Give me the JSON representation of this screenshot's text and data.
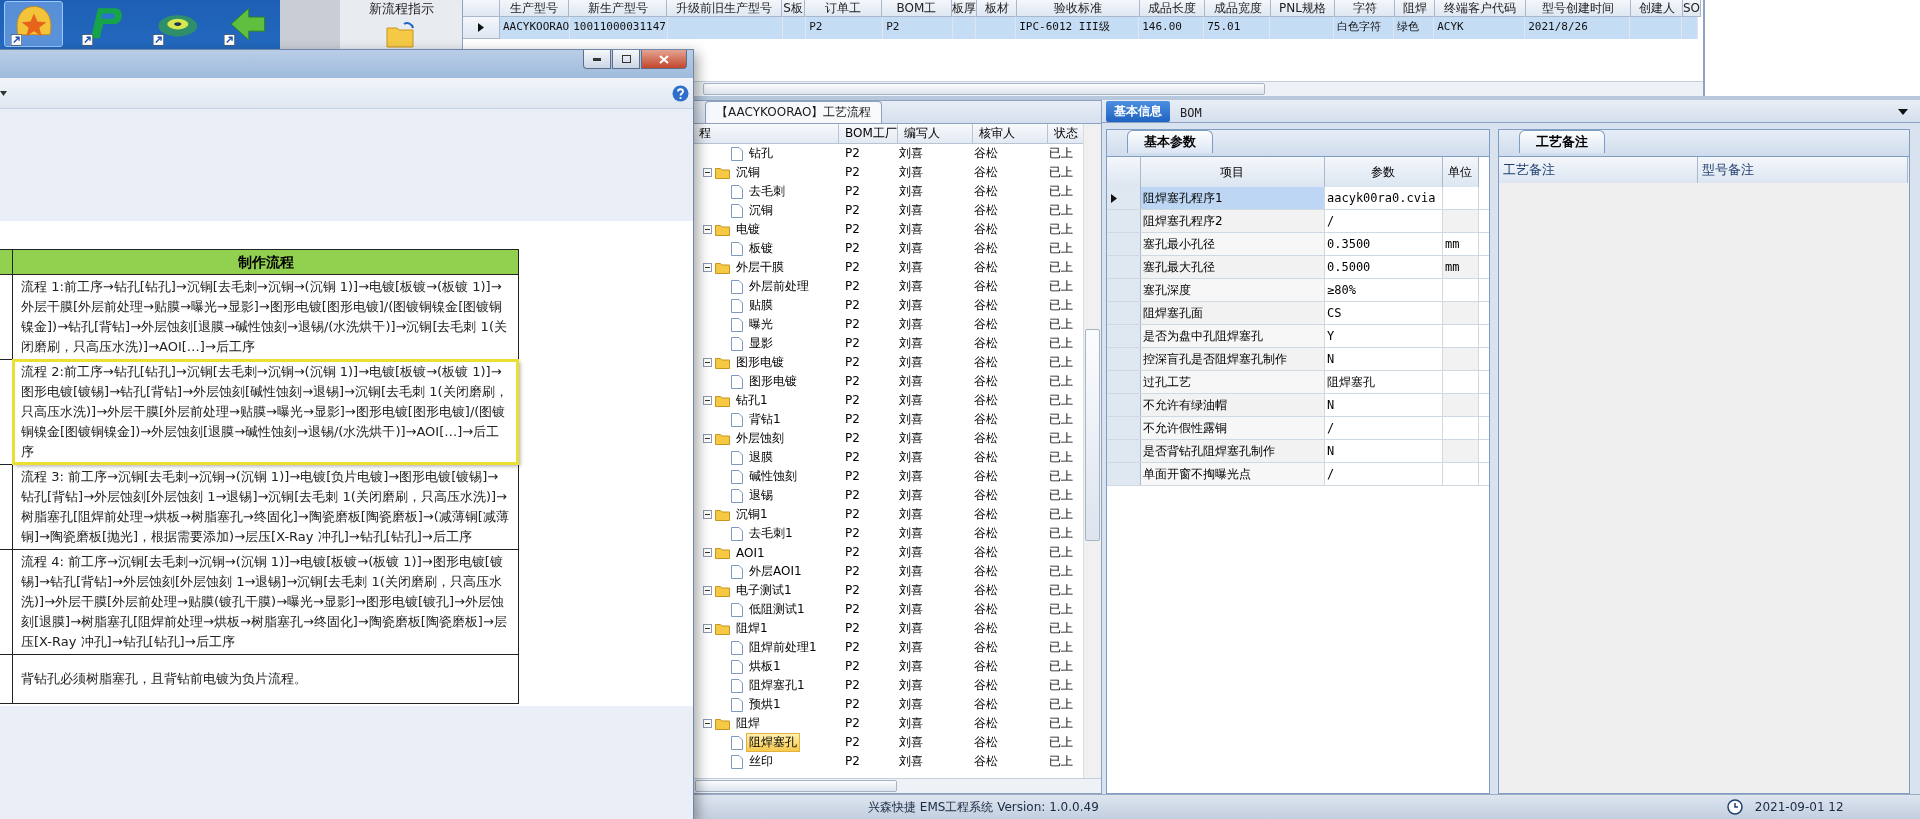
{
  "desktop": {
    "icons": [
      {
        "kind": "shell",
        "selected": true
      },
      {
        "kind": "letter",
        "selected": false
      },
      {
        "kind": "disc",
        "selected": false
      },
      {
        "kind": "arrow",
        "selected": false
      }
    ]
  },
  "sidebar": {
    "label": "新流程指示"
  },
  "model_grid": {
    "columns": [
      "生产型号",
      "新生产型号",
      "升级前旧生产型号",
      "S板",
      "订单工",
      "BOM工",
      "板厚",
      "板材",
      "验收标准",
      "成品长度",
      "成品宽度",
      "PNL规格",
      "字符",
      "阻焊",
      "终端客户代码",
      "型号创建时间",
      "创建人",
      "SO"
    ],
    "rows": [
      {
        "selected": true,
        "cells": [
          "AACYKOORAO",
          "10011000031147",
          "",
          "",
          "P2",
          "P2",
          "",
          "",
          "IPC-6012 III级",
          "146.00",
          "75.01",
          "",
          "白色字符",
          "绿色",
          "ACYK",
          "2021/8/26",
          "",
          ""
        ]
      }
    ]
  },
  "flow_panel": {
    "tab": "【AACYKOORAO】工艺流程",
    "columns": [
      "程",
      "BOM工厂",
      "编写人",
      "核审人",
      "状态"
    ],
    "tree": [
      {
        "children": [
          {
            "label": "钻孔",
            "bom": "P2",
            "writer": "刘喜",
            "reviewer": "谷松",
            "status": "已上",
            "selected": false
          }
        ]
      },
      {
        "label": "沉铜",
        "expanded": true,
        "bom": "P2",
        "writer": "刘喜",
        "reviewer": "谷松",
        "status": "已上",
        "selected": false,
        "children": [
          {
            "label": "去毛刺",
            "bom": "P2",
            "writer": "刘喜",
            "reviewer": "谷松",
            "status": "已上",
            "selected": false
          },
          {
            "label": "沉铜",
            "bom": "P2",
            "writer": "刘喜",
            "reviewer": "谷松",
            "status": "已上",
            "selected": false
          }
        ]
      },
      {
        "label": "电镀",
        "expanded": true,
        "bom": "P2",
        "writer": "刘喜",
        "reviewer": "谷松",
        "status": "已上",
        "selected": false,
        "children": [
          {
            "label": "板镀",
            "bom": "P2",
            "writer": "刘喜",
            "reviewer": "谷松",
            "status": "已上",
            "selected": false
          }
        ]
      },
      {
        "label": "外层干膜",
        "expanded": true,
        "bom": "P2",
        "writer": "刘喜",
        "reviewer": "谷松",
        "status": "已上",
        "selected": false,
        "children": [
          {
            "label": "外层前处理",
            "bom": "P2",
            "writer": "刘喜",
            "reviewer": "谷松",
            "status": "已上",
            "selected": false
          },
          {
            "label": "贴膜",
            "bom": "P2",
            "writer": "刘喜",
            "reviewer": "谷松",
            "status": "已上",
            "selected": false
          },
          {
            "label": "曝光",
            "bom": "P2",
            "writer": "刘喜",
            "reviewer": "谷松",
            "status": "已上",
            "selected": false
          },
          {
            "label": "显影",
            "bom": "P2",
            "writer": "刘喜",
            "reviewer": "谷松",
            "status": "已上",
            "selected": false
          }
        ]
      },
      {
        "label": "图形电镀",
        "expanded": true,
        "bom": "P2",
        "writer": "刘喜",
        "reviewer": "谷松",
        "status": "已上",
        "selected": false,
        "children": [
          {
            "label": "图形电镀",
            "bom": "P2",
            "writer": "刘喜",
            "reviewer": "谷松",
            "status": "已上",
            "selected": false
          }
        ]
      },
      {
        "label": "钻孔1",
        "expanded": true,
        "bom": "P2",
        "writer": "刘喜",
        "reviewer": "谷松",
        "status": "已上",
        "selected": false,
        "children": [
          {
            "label": "背钻1",
            "bom": "P2",
            "writer": "刘喜",
            "reviewer": "谷松",
            "status": "已上",
            "selected": false
          }
        ]
      },
      {
        "label": "外层蚀刻",
        "expanded": true,
        "bom": "P2",
        "writer": "刘喜",
        "reviewer": "谷松",
        "status": "已上",
        "selected": false,
        "children": [
          {
            "label": "退膜",
            "bom": "P2",
            "writer": "刘喜",
            "reviewer": "谷松",
            "status": "已上",
            "selected": false
          },
          {
            "label": "碱性蚀刻",
            "bom": "P2",
            "writer": "刘喜",
            "reviewer": "谷松",
            "status": "已上",
            "selected": false
          },
          {
            "label": "退锡",
            "bom": "P2",
            "writer": "刘喜",
            "reviewer": "谷松",
            "status": "已上",
            "selected": false
          }
        ]
      },
      {
        "label": "沉铜1",
        "expanded": true,
        "bom": "P2",
        "writer": "刘喜",
        "reviewer": "谷松",
        "status": "已上",
        "selected": false,
        "children": [
          {
            "label": "去毛刺1",
            "bom": "P2",
            "writer": "刘喜",
            "reviewer": "谷松",
            "status": "已上",
            "selected": false
          }
        ]
      },
      {
        "label": "AOI1",
        "expanded": true,
        "bom": "P2",
        "writer": "刘喜",
        "reviewer": "谷松",
        "status": "已上",
        "selected": false,
        "children": [
          {
            "label": "外层AOI1",
            "bom": "P2",
            "writer": "刘喜",
            "reviewer": "谷松",
            "status": "已上",
            "selected": false
          }
        ]
      },
      {
        "label": "电子测试1",
        "expanded": true,
        "bom": "P2",
        "writer": "刘喜",
        "reviewer": "谷松",
        "status": "已上",
        "selected": false,
        "children": [
          {
            "label": "低阻测试1",
            "bom": "P2",
            "writer": "刘喜",
            "reviewer": "谷松",
            "status": "已上",
            "selected": false
          }
        ]
      },
      {
        "label": "阻焊1",
        "expanded": true,
        "bom": "P2",
        "writer": "刘喜",
        "reviewer": "谷松",
        "status": "已上",
        "selected": false,
        "children": [
          {
            "label": "阻焊前处理1",
            "bom": "P2",
            "writer": "刘喜",
            "reviewer": "谷松",
            "status": "已上",
            "selected": false
          },
          {
            "label": "烘板1",
            "bom": "P2",
            "writer": "刘喜",
            "reviewer": "谷松",
            "status": "已上",
            "selected": false
          },
          {
            "label": "阻焊塞孔1",
            "bom": "P2",
            "writer": "刘喜",
            "reviewer": "谷松",
            "status": "已上",
            "selected": false
          },
          {
            "label": "预烘1",
            "bom": "P2",
            "writer": "刘喜",
            "reviewer": "谷松",
            "status": "已上",
            "selected": false
          }
        ]
      },
      {
        "label": "阻焊",
        "expanded": true,
        "bom": "P2",
        "writer": "刘喜",
        "reviewer": "谷松",
        "status": "已上",
        "selected": false,
        "children": [
          {
            "label": "阻焊塞孔",
            "bom": "P2",
            "writer": "刘喜",
            "reviewer": "谷松",
            "status": "已上",
            "selected": true
          },
          {
            "label": "丝印",
            "bom": "P2",
            "writer": "刘喜",
            "reviewer": "谷松",
            "status": "已上",
            "selected": false
          }
        ]
      }
    ]
  },
  "info_panel": {
    "tabs": [
      {
        "label": "基本信息",
        "selected": true
      },
      {
        "label": "BOM",
        "selected": false
      }
    ],
    "params": {
      "tab": "基本参数",
      "columns": [
        "项目",
        "参数",
        "单位"
      ],
      "rows": [
        {
          "item": "阻焊塞孔程序1",
          "value": "aacyk00ra0.cvia",
          "unit": "",
          "selected": true
        },
        {
          "item": "阻焊塞孔程序2",
          "value": "/",
          "unit": "",
          "selected": false
        },
        {
          "item": "塞孔最小孔径",
          "value": "0.3500",
          "unit": "mm",
          "selected": false
        },
        {
          "item": "塞孔最大孔径",
          "value": "0.5000",
          "unit": "mm",
          "selected": false
        },
        {
          "item": "塞孔深度",
          "value": "≥80%",
          "unit": "",
          "selected": false
        },
        {
          "item": "阻焊塞孔面",
          "value": "CS",
          "unit": "",
          "selected": false
        },
        {
          "item": "是否为盘中孔阻焊塞孔",
          "value": "Y",
          "unit": "",
          "selected": false
        },
        {
          "item": "控深盲孔是否阻焊塞孔制作",
          "value": "N",
          "unit": "",
          "selected": false
        },
        {
          "item": "过孔工艺",
          "value": "阻焊塞孔",
          "unit": "",
          "selected": false
        },
        {
          "item": "不允许有绿油帽",
          "value": "N",
          "unit": "",
          "selected": false
        },
        {
          "item": "不允许假性露铜",
          "value": "/",
          "unit": "",
          "selected": false
        },
        {
          "item": "是否背钻孔阻焊塞孔制作",
          "value": "N",
          "unit": "",
          "selected": false
        },
        {
          "item": "单面开窗不掏曝光点",
          "value": "/",
          "unit": "",
          "selected": false
        }
      ]
    },
    "remarks": {
      "tab": "工艺备注",
      "columns": [
        "工艺备注",
        "型号备注"
      ]
    }
  },
  "popup": {
    "header": "制作流程",
    "rows": [
      {
        "text": "流程 1:前工序→钻孔[钻孔]→沉铜[去毛刺→沉铜→(沉铜 1)]→电镀[板镀→(板镀 1)]→外层干膜[外层前处理→贴膜→曝光→显影]→图形电镀[图形电镀]/(图镀铜镍金[图镀铜镍金])→钻孔[背钻]→外层蚀刻[退膜→碱性蚀刻→退锡/(水洗烘干)]→沉铜[去毛刺 1(关闭磨刷，只高压水洗)]→AOI[…]→后工序",
        "highlighted": false
      },
      {
        "text": "流程 2:前工序→钻孔[钻孔]→沉铜[去毛刺→沉铜→(沉铜 1)]→电镀[板镀→(板镀 1)]→图形电镀[镀锡]→钻孔[背钻]→外层蚀刻[碱性蚀刻→退锡]→沉铜[去毛刺 1(关闭磨刷，只高压水洗)]→外层干膜[外层前处理→贴膜→曝光→显影]→图形电镀[图形电镀]/(图镀铜镍金[图镀铜镍金])→外层蚀刻[退膜→碱性蚀刻→退锡/(水洗烘干)]→AOI[…]→后工序",
        "highlighted": true
      },
      {
        "text": "流程 3: 前工序→沉铜[去毛刺→沉铜→(沉铜 1)]→电镀[负片电镀]→图形电镀[镀锡]→钻孔[背钻]→外层蚀刻[外层蚀刻 1→退锡]→沉铜[去毛刺 1(关闭磨刷，只高压水洗)]→树脂塞孔[阻焊前处理→烘板→树脂塞孔→终固化]→陶瓷磨板[陶瓷磨板]→(减薄铜[减薄铜]→陶瓷磨板[抛光]，根据需要添加)→层压[X-Ray 冲孔]→钻孔[钻孔]→后工序",
        "highlighted": false
      },
      {
        "text": "流程 4: 前工序→沉铜[去毛刺→沉铜→(沉铜 1)]→电镀[板镀→(板镀 1)]→图形电镀[镀锡]→钻孔[背钻]→外层蚀刻[外层蚀刻 1→退锡]→沉铜[去毛刺 1(关闭磨刷，只高压水洗)]→外层干膜[外层前处理→贴膜(镀孔干膜)→曝光→显影]→图形电镀[镀孔]→外层蚀刻[退膜]→树脂塞孔[阻焊前处理→烘板→树脂塞孔→终固化]→陶瓷磨板[陶瓷磨板]→层压[X-Ray 冲孔]→钻孔[钻孔]→后工序",
        "highlighted": false
      },
      {
        "text": "背钻孔必须树脂塞孔，且背钻前电镀为负片流程。",
        "highlighted": false
      }
    ]
  },
  "status_bar": {
    "product": "兴森快捷 EMS工程系统 Version: 1.0.0.49",
    "clock": "2021-09-01 12"
  }
}
